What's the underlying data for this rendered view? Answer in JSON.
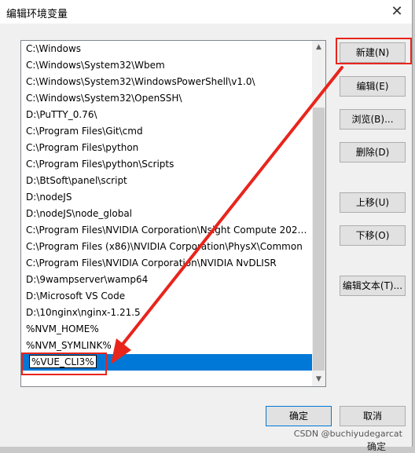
{
  "dialog": {
    "title": "编辑环境变量",
    "close_glyph": "✕"
  },
  "path_list": {
    "items": [
      "C:\\Windows",
      "C:\\Windows\\System32\\Wbem",
      "C:\\Windows\\System32\\WindowsPowerShell\\v1.0\\",
      "C:\\Windows\\System32\\OpenSSH\\",
      "D:\\PuTTY_0.76\\",
      "C:\\Program Files\\Git\\cmd",
      "C:\\Program Files\\python",
      "C:\\Program Files\\python\\Scripts",
      "D:\\BtSoft\\panel\\script",
      "D:\\nodeJS",
      "D:\\nodeJS\\node_global",
      "C:\\Program Files\\NVIDIA Corporation\\Nsight Compute 2021....",
      "C:\\Program Files (x86)\\NVIDIA Corporation\\PhysX\\Common",
      "C:\\Program Files\\NVIDIA Corporation\\NVIDIA NvDLISR",
      "D:\\9wampserver\\wamp64",
      "D:\\Microsoft VS Code",
      "D:\\10nginx\\nginx-1.21.5",
      "%NVM_HOME%",
      "%NVM_SYMLINK%"
    ],
    "editing_value": "%VUE_CLI3%",
    "scroll_up_glyph": "▲",
    "scroll_down_glyph": "▼"
  },
  "buttons": {
    "new": "新建(N)",
    "edit": "编辑(E)",
    "browse": "浏览(B)...",
    "delete": "删除(D)",
    "move_up": "上移(U)",
    "move_down": "下移(O)",
    "edit_text": "编辑文本(T)...",
    "ok": "确定",
    "cancel": "取消"
  },
  "annotation": {
    "color": "#e8251c"
  },
  "watermark": "CSDN @buchiyudegarcat",
  "background_text": "确定"
}
